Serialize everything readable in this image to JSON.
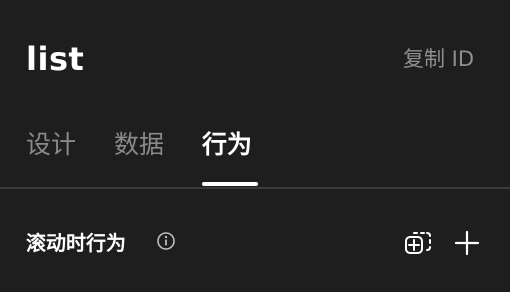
{
  "header": {
    "title": "list",
    "copy_id_label": "复制 ID"
  },
  "tabs": [
    {
      "label": "设计",
      "active": false
    },
    {
      "label": "数据",
      "active": false
    },
    {
      "label": "行为",
      "active": true
    }
  ],
  "section": {
    "label": "滚动时行为",
    "icons": [
      "info-icon",
      "duplicate-add-icon",
      "plus-icon"
    ]
  },
  "colors": {
    "background": "#1e1e1e",
    "text_primary": "#ffffff",
    "text_secondary": "#8a8a8a",
    "divider": "#3a3a3a"
  }
}
